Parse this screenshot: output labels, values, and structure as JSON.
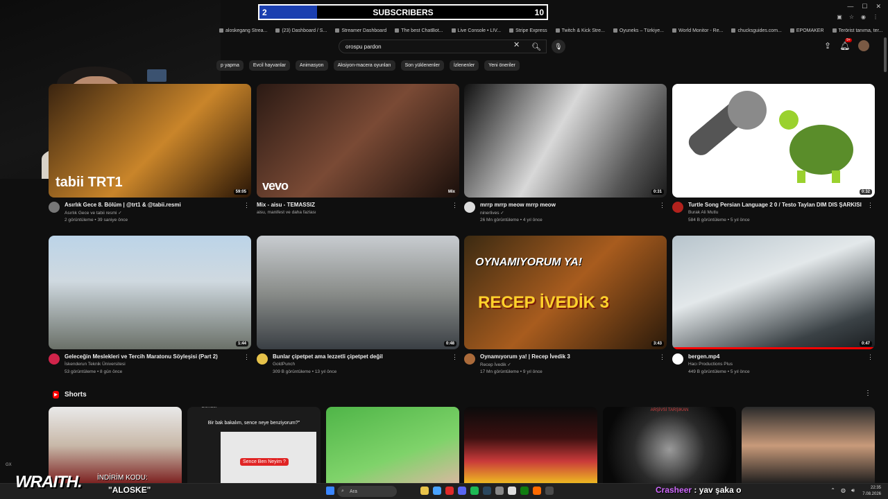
{
  "subscriber_goal": {
    "current": "2",
    "label": "SUBSCRIBERS",
    "goal": "10",
    "progress_fraction": 0.2
  },
  "bookmarks": [
    "aloskegang Strea...",
    "(23) Dashboard / S...",
    "Streamer Dashboard",
    "The best ChatBot...",
    "Live Console • LIV...",
    "Stripe Express",
    "Twitch & Kick Stre...",
    "Oyuneks – Türkiye...",
    "World Monitor - Re...",
    "chucksguides.com...",
    "EPOMAKER",
    "Terörist tanıma, ter..."
  ],
  "search": {
    "value": "orospu pardon"
  },
  "notifications": {
    "badge": "9+"
  },
  "chips": [
    "p yapma",
    "Evcil hayvanlar",
    "Animasyon",
    "Aksiyon-macera oyunları",
    "Son yüklenenler",
    "İzlenenler",
    "Yeni öneriler"
  ],
  "videos": [
    {
      "title": "Asırlık Gece 8. Bölüm | @trt1 & @tabii.resmi",
      "channel": "Asırlık Gece ve tabii resmi ✓",
      "stats": "2 görüntüleme • 39 saniye önce",
      "duration": "59:05",
      "overlay": "tabii TRT1"
    },
    {
      "title": "Mix - aisu - TEMASSIZ",
      "channel": "aisu, manifest ve daha fazlası",
      "stats": "",
      "duration": "Mix",
      "overlay": "vevo"
    },
    {
      "title": "mrrp mrrp meow mrrp meow",
      "channel": "ninerlives ✓",
      "stats": "26 Mn görüntüleme • 4 yıl önce",
      "duration": "0:31"
    },
    {
      "title": "Turtle Song Persian Language 2 0 / Testo Taylan DIM DIS ŞARKISI",
      "channel": "Burak Ali Mutlu",
      "stats": "584 B görüntüleme • 5 yıl önce",
      "duration": "0:32"
    },
    {
      "title": "Geleceğin Meslekleri ve Tercih Maratonu Söyleşisi (Part 2)",
      "channel": "İskenderun Teknik Üniversitesi",
      "stats": "53 görüntüleme • 8 gün önce",
      "duration": "1:44"
    },
    {
      "title": "Bunlar çipetpet ama lezzetli çipetpet değil",
      "channel": "GoldPunch",
      "stats": "309 B görüntüleme • 13 yıl önce",
      "duration": "0:48"
    },
    {
      "title": "Oynamıyorum ya! | Recep İvedik 3",
      "channel": "Recep İvedik ✓",
      "stats": "17 Mn görüntüleme • 9 yıl önce",
      "duration": "3:43",
      "overlay_top": "OYNAMIYORUM YA!",
      "overlay_main": "RECEP İVEDİK 3"
    },
    {
      "title": "bergen.mp4",
      "channel": "Hacı Productions Plus",
      "stats": "449 B görüntüleme • 5 yıl önce",
      "duration": "0:47"
    }
  ],
  "shorts": {
    "title": "Shorts",
    "items": [
      {
        "caption": ""
      },
      {
        "caption": "Bir bak bakalım, sence neye benziyorum?\"",
        "sticker": "Sence Ben Neyim ?",
        "top": "Gonder"
      },
      {
        "caption": ""
      },
      {
        "caption": ""
      },
      {
        "caption": "ARŞİVSİ TARŞIKAN"
      },
      {
        "caption": ""
      }
    ]
  },
  "taskbar": {
    "search_placeholder": "Ara",
    "time": "22:35",
    "date": "7.08.2026"
  },
  "stream_overlay": {
    "brand": "WRAITH.",
    "promo_label": "İNDİRİM KODU:",
    "promo_code": "\"ALOSKE\"",
    "chat_user": "Crasheer",
    "chat_message": ": yav şaka o",
    "gx": "GX"
  },
  "colors": {
    "youtube_red": "#ff0000",
    "sub_fill": "#1b3fb0",
    "chat_user": "#d16bff"
  }
}
